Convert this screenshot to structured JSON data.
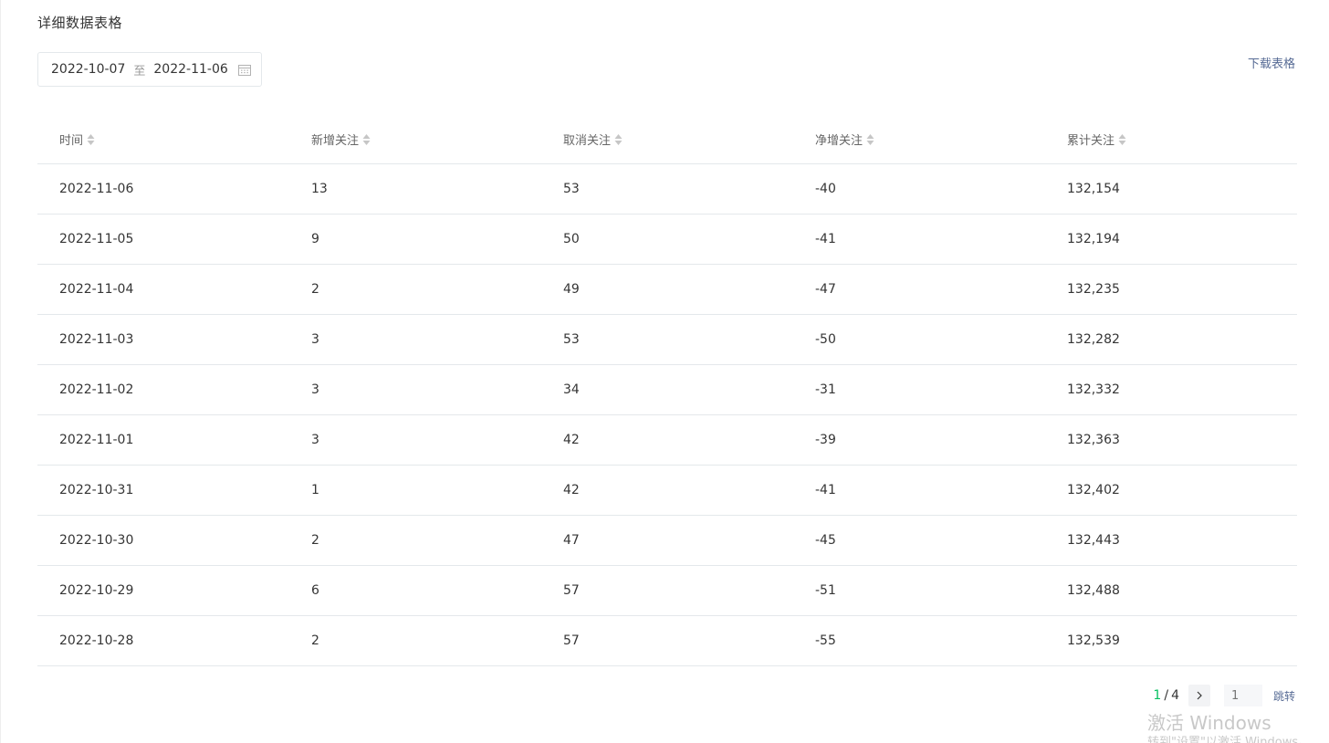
{
  "section": {
    "title": "详细数据表格"
  },
  "date_range": {
    "start": "2022-10-07",
    "separator": "至",
    "end": "2022-11-06",
    "icon": "calendar-icon"
  },
  "download": {
    "label": "下载表格"
  },
  "table": {
    "headers": [
      "时间",
      "新增关注",
      "取消关注",
      "净增关注",
      "累计关注"
    ],
    "sort_icon": "sort-icon",
    "rows": [
      [
        "2022-11-06",
        "13",
        "53",
        "-40",
        "132,154"
      ],
      [
        "2022-11-05",
        "9",
        "50",
        "-41",
        "132,194"
      ],
      [
        "2022-11-04",
        "2",
        "49",
        "-47",
        "132,235"
      ],
      [
        "2022-11-03",
        "3",
        "53",
        "-50",
        "132,282"
      ],
      [
        "2022-11-02",
        "3",
        "34",
        "-31",
        "132,332"
      ],
      [
        "2022-11-01",
        "3",
        "42",
        "-39",
        "132,363"
      ],
      [
        "2022-10-31",
        "1",
        "42",
        "-41",
        "132,402"
      ],
      [
        "2022-10-30",
        "2",
        "47",
        "-45",
        "132,443"
      ],
      [
        "2022-10-29",
        "6",
        "57",
        "-51",
        "132,488"
      ],
      [
        "2022-10-28",
        "2",
        "57",
        "-55",
        "132,539"
      ]
    ]
  },
  "pagination": {
    "current": "1",
    "separator": "/",
    "total": "4",
    "input_placeholder": "1",
    "jump_label": "跳转"
  },
  "watermark": {
    "line1": "激活 Windows",
    "line2": "转到\"设置\"以激活 Windows。"
  },
  "colors": {
    "accent_green": "#07c160",
    "link_blue": "#576b95",
    "border": "#e4e8eb"
  }
}
